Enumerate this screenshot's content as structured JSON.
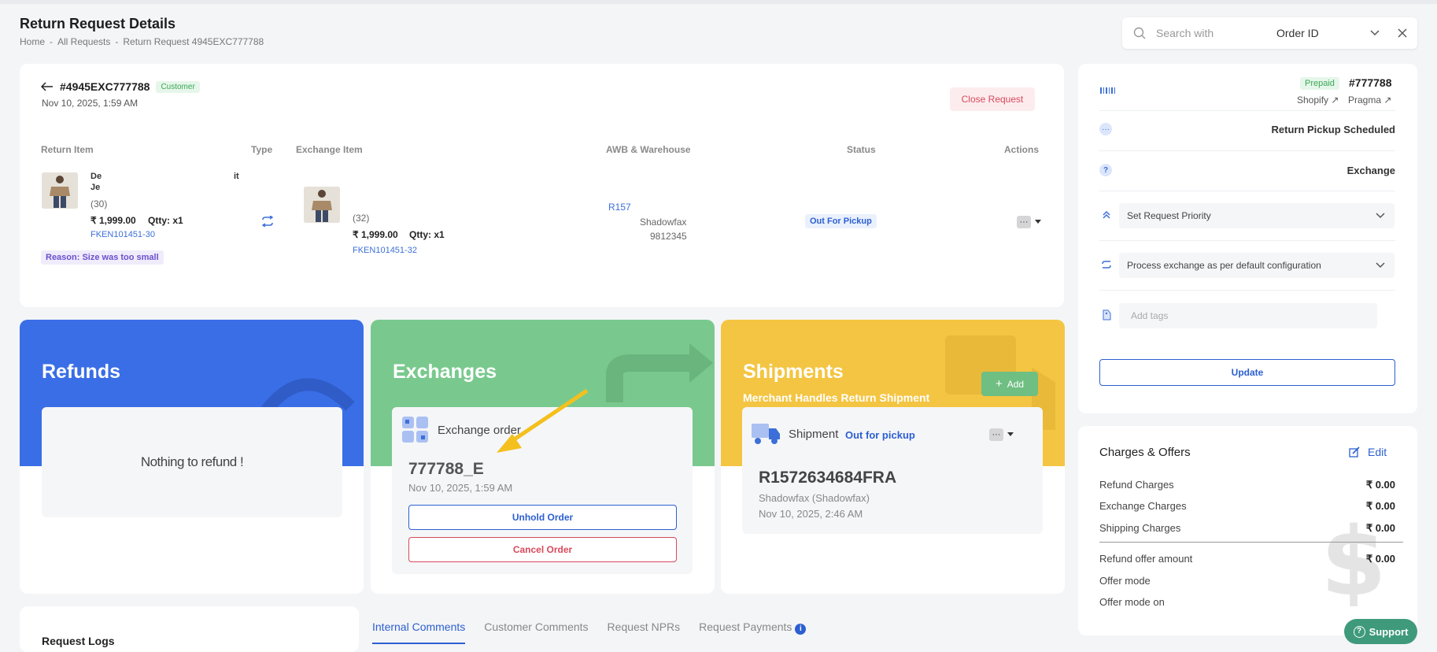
{
  "header": {
    "title": "Return Request Details",
    "breadcrumbs": [
      "Home",
      "-",
      "All Requests",
      "-",
      "Return Request 4945EXC777788"
    ]
  },
  "search": {
    "placeholder": "Search with",
    "selected": "Order ID"
  },
  "request": {
    "id": "#4945EXC777788",
    "tag": "Customer",
    "date": "Nov 10, 2025, 1:59 AM",
    "close_label": "Close Request",
    "columns": [
      "Return Item",
      "Type",
      "Exchange Item",
      "AWB & Warehouse",
      "Status",
      "Actions"
    ],
    "return_item": {
      "name_line1": "De",
      "name_end": "it",
      "name_line2": "Je",
      "size": "(30)",
      "price": "₹ 1,999.00",
      "qty": "Qtty: x1",
      "sku": "FKEN101451-30",
      "reason": "Reason: Size was too small"
    },
    "exchange_item": {
      "size": "(32)",
      "price": "₹ 1,999.00",
      "qty": "Qtty: x1",
      "sku": "FKEN101451-32"
    },
    "awb": "R157",
    "warehouse": "Shadowfax",
    "warehouse_code": "9812345",
    "status": "Out For Pickup",
    "more": "···"
  },
  "right_panel": {
    "payment_badge": "Prepaid",
    "order_no": "#777788",
    "links": [
      "Shopify",
      "Pragma"
    ],
    "pickup_status": "Return Pickup Scheduled",
    "type": "Exchange",
    "priority_label": "Set Request Priority",
    "exchange_config": "Process exchange as per default configuration",
    "tags_placeholder": "Add tags",
    "update_label": "Update"
  },
  "charges": {
    "title": "Charges & Offers",
    "edit_label": "Edit",
    "rows": [
      {
        "label": "Refund Charges",
        "value": "₹ 0.00"
      },
      {
        "label": "Exchange Charges",
        "value": "₹ 0.00"
      },
      {
        "label": "Shipping Charges",
        "value": "₹ 0.00"
      },
      {
        "label": "Refund offer amount",
        "value": "₹ 0.00"
      },
      {
        "label": "Offer mode",
        "value": ""
      },
      {
        "label": "Offer mode on",
        "value": ""
      }
    ]
  },
  "refunds": {
    "title": "Refunds",
    "empty": "Nothing to refund !"
  },
  "exchanges": {
    "title": "Exchanges",
    "card_title": "Exchange order",
    "order_id": "777788_E",
    "date": "Nov 10, 2025, 1:59 AM",
    "unhold_label": "Unhold Order",
    "cancel_label": "Cancel Order"
  },
  "shipments": {
    "title": "Shipments",
    "subtitle": "Merchant Handles Return Shipment",
    "add_label": "Add",
    "card_title": "Shipment",
    "card_status": "Out for pickup",
    "awb": "R1572634684FRA",
    "carrier": "Shadowfax (Shadowfax)",
    "date": "Nov 10, 2025, 2:46 AM"
  },
  "logs": {
    "title": "Request Logs"
  },
  "tabs": [
    {
      "label": "Internal Comments"
    },
    {
      "label": "Customer Comments"
    },
    {
      "label": "Request NPRs"
    },
    {
      "label": "Request Payments"
    }
  ],
  "support_label": "Support",
  "colors": {
    "refunds": "#3a6ee6",
    "exchanges": "#79c98e",
    "shipments": "#f4c542",
    "primary": "#2c5fd1",
    "danger": "#d84a5c"
  }
}
